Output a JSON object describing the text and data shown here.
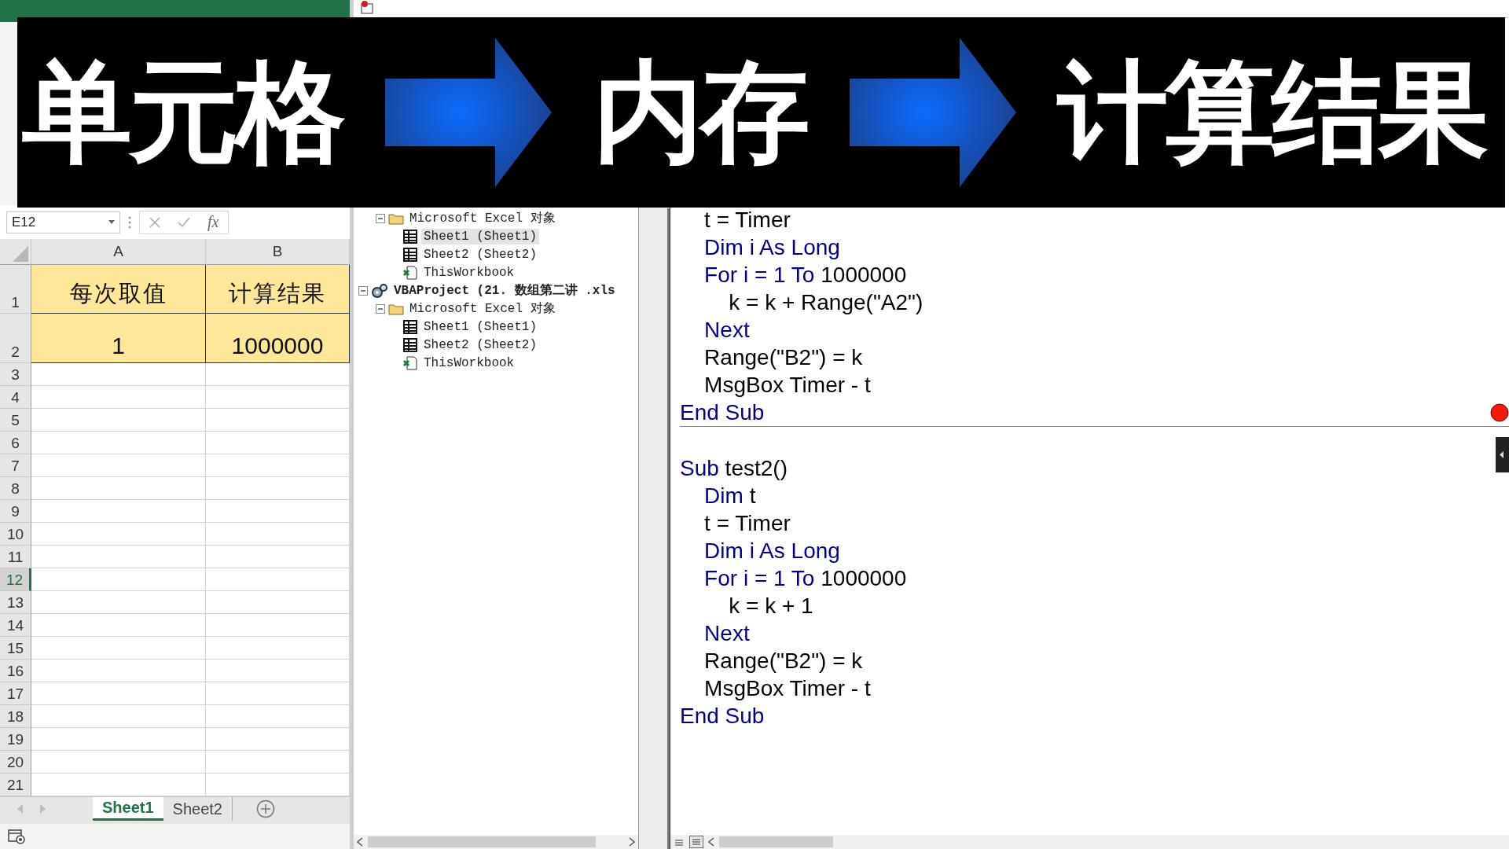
{
  "banner": {
    "steps": [
      "单元格",
      "内存",
      "计算结果"
    ]
  },
  "excel": {
    "name_box": "E12",
    "function_label": "fx",
    "columns": [
      "A",
      "B"
    ],
    "rows": [
      {
        "label": "1",
        "selected": false,
        "color": "#ffe699",
        "cells": [
          "每次取值",
          "计算结果"
        ]
      },
      {
        "label": "2",
        "selected": false,
        "color": "#ffe699",
        "cells": [
          "1",
          "1000000"
        ]
      },
      {
        "label": "3",
        "selected": false
      },
      {
        "label": "4",
        "selected": false
      },
      {
        "label": "5",
        "selected": false
      },
      {
        "label": "6",
        "selected": false
      },
      {
        "label": "7",
        "selected": false
      },
      {
        "label": "8",
        "selected": false
      },
      {
        "label": "9",
        "selected": false
      },
      {
        "label": "10",
        "selected": false
      },
      {
        "label": "11",
        "selected": false
      },
      {
        "label": "12",
        "selected": true
      },
      {
        "label": "13",
        "selected": false
      },
      {
        "label": "14",
        "selected": false
      },
      {
        "label": "15",
        "selected": false
      },
      {
        "label": "16",
        "selected": false
      },
      {
        "label": "17",
        "selected": false
      },
      {
        "label": "18",
        "selected": false
      },
      {
        "label": "19",
        "selected": false
      },
      {
        "label": "20",
        "selected": false
      },
      {
        "label": "21",
        "selected": false
      }
    ],
    "sheet_tabs": [
      {
        "label": "Sheet1",
        "selected": true
      },
      {
        "label": "Sheet2",
        "selected": false
      }
    ]
  },
  "project_tree": {
    "items": [
      {
        "kind": "folder",
        "label": "Microsoft Excel 对象",
        "expanded": true,
        "selected": false,
        "children": [
          {
            "kind": "sheet",
            "label": "Sheet1 (Sheet1)",
            "selected": true
          },
          {
            "kind": "sheet",
            "label": "Sheet2 (Sheet2)",
            "selected": false
          },
          {
            "kind": "workbook",
            "label": "ThisWorkbook",
            "selected": false
          }
        ]
      },
      {
        "kind": "project",
        "label": "VBAProject (21. 数组第二讲 .xls",
        "expanded": true,
        "selected": false,
        "children": [
          {
            "kind": "folder",
            "label": "Microsoft Excel 对象",
            "expanded": true,
            "selected": false,
            "children": [
              {
                "kind": "sheet",
                "label": "Sheet1 (Sheet1)",
                "selected": false
              },
              {
                "kind": "sheet",
                "label": "Sheet2 (Sheet2)",
                "selected": false
              },
              {
                "kind": "workbook",
                "label": "ThisWorkbook",
                "selected": false
              }
            ]
          }
        ]
      }
    ]
  },
  "code": {
    "procedures": [
      {
        "lines": [
          [
            {
              "kind": "plain",
              "text": "    t = Timer"
            }
          ],
          [
            {
              "kind": "keyword",
              "text": "    Dim i As Long"
            }
          ],
          [
            {
              "kind": "keyword",
              "text": "    For i = 1 To"
            },
            {
              "kind": "plain",
              "text": " 1000000"
            }
          ],
          [
            {
              "kind": "plain",
              "text": "        k = k + Range(\"A2\")"
            }
          ],
          [
            {
              "kind": "keyword",
              "text": "    Next"
            }
          ],
          [
            {
              "kind": "plain",
              "text": "    Range(\"B2\") = k"
            }
          ],
          [
            {
              "kind": "plain",
              "text": "    MsgBox Timer - t"
            }
          ],
          [
            {
              "kind": "keyword",
              "text": "End Sub"
            }
          ]
        ]
      },
      {
        "lines": [
          [
            {
              "kind": "keyword",
              "text": "Sub"
            },
            {
              "kind": "plain",
              "text": " test2()"
            }
          ],
          [
            {
              "kind": "keyword",
              "text": "    Dim"
            },
            {
              "kind": "plain",
              "text": " t"
            }
          ],
          [
            {
              "kind": "plain",
              "text": "    t = Timer"
            }
          ],
          [
            {
              "kind": "keyword",
              "text": "    Dim i As Long"
            }
          ],
          [
            {
              "kind": "keyword",
              "text": "    For i = 1 To"
            },
            {
              "kind": "plain",
              "text": " 1000000"
            }
          ],
          [
            {
              "kind": "plain",
              "text": "        k = k + 1"
            }
          ],
          [
            {
              "kind": "keyword",
              "text": "    Next"
            }
          ],
          [
            {
              "kind": "plain",
              "text": "    Range(\"B2\") = k"
            }
          ],
          [
            {
              "kind": "plain",
              "text": "    MsgBox Timer - t"
            }
          ],
          [
            {
              "kind": "keyword",
              "text": "End Sub"
            }
          ]
        ]
      }
    ]
  }
}
